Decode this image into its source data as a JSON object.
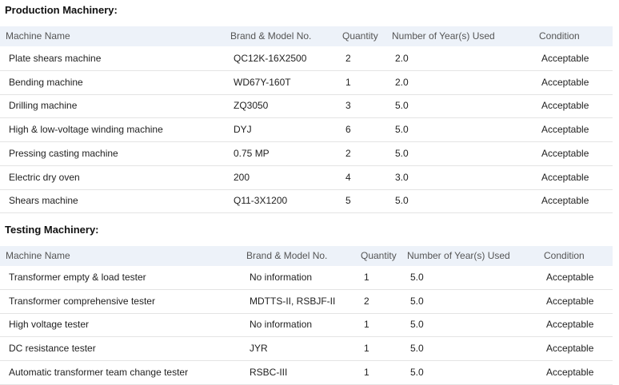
{
  "production": {
    "title": "Production Machinery:",
    "headers": [
      "Machine Name",
      "Brand & Model No.",
      "Quantity",
      "Number of Year(s) Used",
      "Condition"
    ],
    "rows": [
      [
        "Plate shears machine",
        "QC12K-16X2500",
        "2",
        "2.0",
        "Acceptable"
      ],
      [
        "Bending machine",
        "WD67Y-160T",
        "1",
        "2.0",
        "Acceptable"
      ],
      [
        "Drilling machine",
        "ZQ3050",
        "3",
        "5.0",
        "Acceptable"
      ],
      [
        "High & low-voltage winding machine",
        "DYJ",
        "6",
        "5.0",
        "Acceptable"
      ],
      [
        "Pressing casting machine",
        "0.75 MP",
        "2",
        "5.0",
        "Acceptable"
      ],
      [
        "Electric dry oven",
        "200",
        "4",
        "3.0",
        "Acceptable"
      ],
      [
        "Shears machine",
        "Q11-3X1200",
        "5",
        "5.0",
        "Acceptable"
      ]
    ]
  },
  "testing": {
    "title": "Testing Machinery:",
    "headers": [
      "Machine Name",
      "Brand & Model No.",
      "Quantity",
      "Number of Year(s) Used",
      "Condition"
    ],
    "rows": [
      [
        "Transformer empty & load tester",
        "No information",
        "1",
        "5.0",
        "Acceptable"
      ],
      [
        "Transformer comprehensive tester",
        "MDTTS-II, RSBJF-II",
        "2",
        "5.0",
        "Acceptable"
      ],
      [
        "High voltage tester",
        "No information",
        "1",
        "5.0",
        "Acceptable"
      ],
      [
        "DC resistance tester",
        "JYR",
        "1",
        "5.0",
        "Acceptable"
      ],
      [
        "Automatic transformer team change tester",
        "RSBC-III",
        "1",
        "5.0",
        "Acceptable"
      ]
    ]
  }
}
